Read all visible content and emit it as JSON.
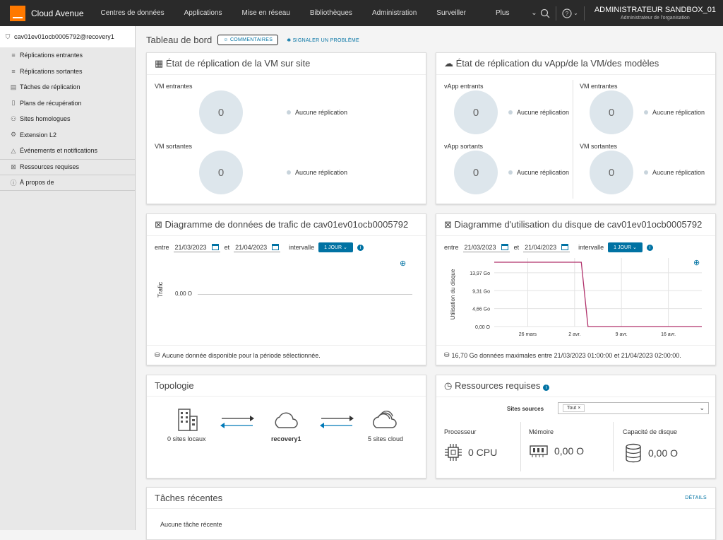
{
  "topbar": {
    "app_name": "Cloud Avenue",
    "nav": [
      "Centres de données",
      "Applications",
      "Mise en réseau",
      "Bibliothèques",
      "Administration",
      "Surveiller",
      "Plus"
    ],
    "user_name": "ADMINISTRATEUR SANDBOX_01",
    "user_role": "Administrateur de l'organisation"
  },
  "sidebar": {
    "items": [
      {
        "icon": "shield-check-icon",
        "label": "cav01ev01ocb0005792@recovery1"
      },
      {
        "icon": "list-in-icon",
        "label": "Réplications entrantes"
      },
      {
        "icon": "list-out-icon",
        "label": "Réplications sortantes"
      },
      {
        "icon": "clipboard-icon",
        "label": "Tâches de réplication"
      },
      {
        "icon": "document-icon",
        "label": "Plans de récupération"
      },
      {
        "icon": "sites-icon",
        "label": "Sites homologues"
      },
      {
        "icon": "extension-icon",
        "label": "Extension L2"
      },
      {
        "icon": "bell-icon",
        "label": "Événements et notifications"
      },
      {
        "icon": "chart-icon",
        "label": "Ressources requises"
      },
      {
        "icon": "info-icon",
        "label": "À propos de"
      }
    ]
  },
  "header": {
    "title": "Tableau de bord",
    "comments": "COMMENTAIRES",
    "report": "SIGNALER UN PROBLÈME"
  },
  "vm_card": {
    "title": "État de réplication de la VM sur site",
    "incoming_label": "VM entrantes",
    "incoming_value": "0",
    "outgoing_label": "VM sortantes",
    "outgoing_value": "0",
    "legend": "Aucune réplication"
  },
  "vapp_card": {
    "title": "État de réplication du vApp/de la VM/des modèles",
    "vapp_in_label": "vApp entrants",
    "vapp_out_label": "vApp sortants",
    "vm_in_label": "VM entrantes",
    "vm_out_label": "VM sortantes",
    "value": "0",
    "legend": "Aucune réplication"
  },
  "traffic_card": {
    "title": "Diagramme de données de trafic de cav01ev01ocb0005792",
    "between": "entre",
    "and": "et",
    "from": "21/03/2023",
    "to": "21/04/2023",
    "interval": "intervalle",
    "interval_value": "1 JOUR",
    "ylabel": "Trafic",
    "ytick": "0,00 O",
    "footer": "Aucune donnée disponible pour la période sélectionnée."
  },
  "disk_card": {
    "title": "Diagramme d'utilisation du disque de cav01ev01ocb0005792",
    "between": "entre",
    "and": "et",
    "from": "21/03/2023",
    "to": "21/04/2023",
    "interval": "intervalle",
    "interval_value": "1 JOUR",
    "footer": "16,70 Go données maximales entre 21/03/2023 01:00:00 et 21/04/2023 02:00:00."
  },
  "chart_data": {
    "type": "line",
    "title": "",
    "ylabel": "Utilisation du disque",
    "yticks": [
      "0,00 O",
      "4,66 Go",
      "9,31 Go",
      "13,97 Go"
    ],
    "xticks": [
      "26 mars",
      "2 avr.",
      "9 avr.",
      "16 avr."
    ],
    "ylim": [
      0,
      16.7
    ],
    "unit": "Go",
    "color": "#b0306a",
    "points": [
      {
        "x": "2023-03-21",
        "y": 16.7
      },
      {
        "x": "2023-04-03",
        "y": 16.7
      },
      {
        "x": "2023-04-04",
        "y": 0
      },
      {
        "x": "2023-04-21",
        "y": 0
      }
    ]
  },
  "topology": {
    "title": "Topologie",
    "local": "0 sites locaux",
    "center": "recovery1",
    "cloud": "5 sites cloud"
  },
  "resources": {
    "title": "Ressources requises",
    "sources_label": "Sites sources",
    "tag": "Tout",
    "cpu_label": "Processeur",
    "cpu_value": "0 CPU",
    "mem_label": "Mémoire",
    "mem_value": "0,00 O",
    "disk_label": "Capacité de disque",
    "disk_value": "0,00 O"
  },
  "tasks": {
    "title": "Tâches récentes",
    "details": "DÉTAILS",
    "empty": "Aucune tâche récente"
  }
}
